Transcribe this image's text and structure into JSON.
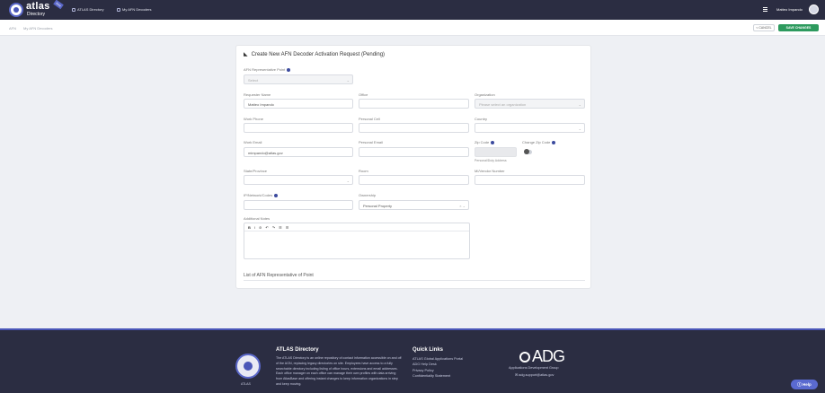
{
  "header": {
    "logo_name": "atlas",
    "logo_sub": "Directory",
    "logo_badge": "Beta",
    "nav": [
      "ATLAS Directory",
      "My AFN Decoders"
    ],
    "username": "Matteo Impando"
  },
  "breadcrumb": [
    "AFN",
    "My AFN Decoders"
  ],
  "actions": {
    "cancel": "< CANCEL",
    "save": "SAVE CHANGES"
  },
  "form": {
    "title": "Create New AFN Decoder Activation Request (Pending)",
    "afn_rep_label": "AFN Representative Point",
    "afn_rep_value": "Select",
    "requester_name_label": "Requester Name",
    "requester_name_value": "Matteo Impando",
    "office_label": "Office",
    "organization_label": "Organization",
    "organization_placeholder": "Please select an organization",
    "work_phone_label": "Work Phone",
    "personal_cell_label": "Personal Cell",
    "country_label": "Country",
    "work_email_label": "Work Email",
    "work_email_value": "mimpando@atlas.gov",
    "personal_email_label": "Personal Email",
    "zip_code_label": "Zip Code",
    "change_zip_label": "Change Zip Code",
    "zip_hint": "Personal/Duty Address",
    "state_label": "State/Province",
    "room_label": "Room",
    "mi_vendor_label": "MI/Vendor Number",
    "ip_access_label": "IP/Network/Codes",
    "ownership_label": "Ownership",
    "ownership_value": "Personal Property",
    "notes_label": "Additional Notes",
    "editor_tools": [
      "B",
      "I",
      "⊘",
      "↶",
      "↷",
      "☰",
      "☰"
    ],
    "list_title": "List of AFN Representative of Point"
  },
  "footer": {
    "logo_caption": "ATLAS",
    "title": "ATLAS Directory",
    "desc": "The ATLAS Directory is an online repository of contact information accessible on and off of the AGN, replacing legacy directories on site. Employees have access to a fully searchable directory including listing of office hours, extensions and email addresses. Each office manager on each office can manage their own profiles with data arriving from AtlasBase and offering instant changes to keep information organizations in step and keep moving.",
    "quick_links_title": "Quick Links",
    "quick_links": [
      "ATLAS Global Applications Portal",
      "ADG Help Desk",
      "Privacy Policy",
      "Confidentiality Statement"
    ],
    "adg_logo": "ADG",
    "adg_sub": "Applications Development Group",
    "adg_mail": "adg.support@atlas.gov"
  },
  "help_label": "Help"
}
